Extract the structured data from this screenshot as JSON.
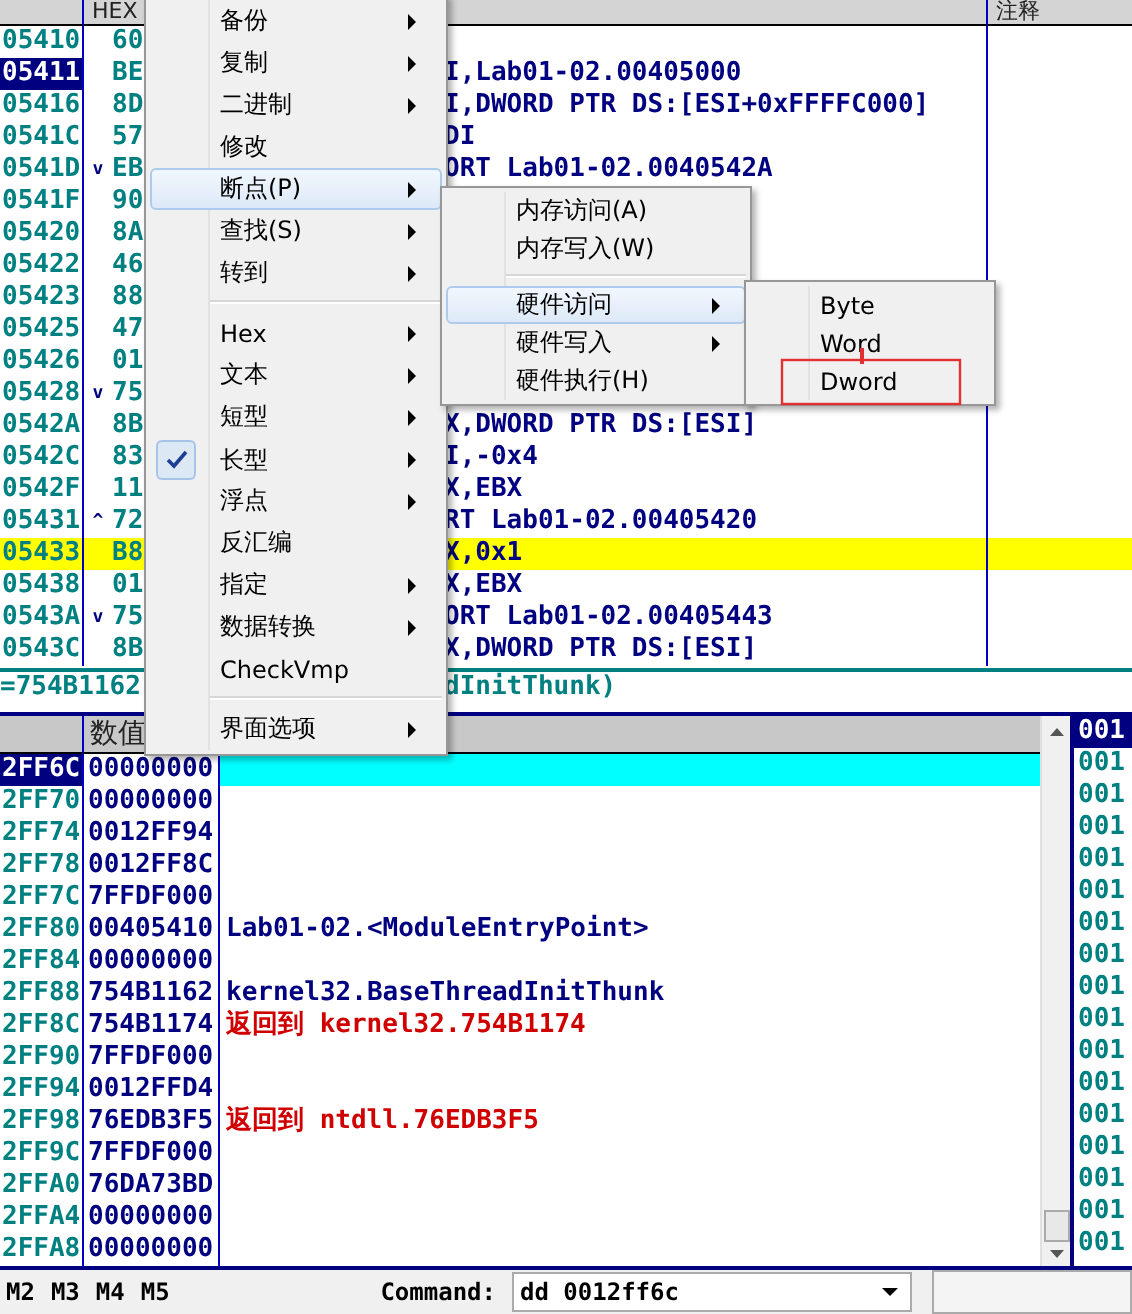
{
  "disassembly": {
    "columns": [
      {
        "label": "HEX"
      },
      {
        "label": "注释"
      }
    ],
    "rows": [
      {
        "address": "05410",
        "hex": "60",
        "jump": "",
        "code": "",
        "selected": false,
        "highlighted": false
      },
      {
        "address": "05411",
        "hex": "BE",
        "jump": "",
        "code": "I,Lab01-02.00405000",
        "selected": true,
        "highlighted": false
      },
      {
        "address": "05416",
        "hex": "8D",
        "jump": "",
        "code": "I,DWORD PTR DS:[ESI+0xFFFFC000]",
        "selected": false,
        "highlighted": false
      },
      {
        "address": "0541C",
        "hex": "57",
        "jump": "",
        "code": "DI",
        "selected": false,
        "highlighted": false
      },
      {
        "address": "0541D",
        "hex": "EB",
        "jump": "v",
        "code": "ORT Lab01-02.0040542A",
        "selected": false,
        "highlighted": false
      },
      {
        "address": "0541F",
        "hex": "90",
        "jump": "",
        "code": "",
        "selected": false,
        "highlighted": false
      },
      {
        "address": "05420",
        "hex": "8A",
        "jump": "",
        "code": "",
        "selected": false,
        "highlighted": false
      },
      {
        "address": "05422",
        "hex": "46",
        "jump": "",
        "code": "",
        "selected": false,
        "highlighted": false
      },
      {
        "address": "05423",
        "hex": "88",
        "jump": "",
        "code": "",
        "selected": false,
        "highlighted": false
      },
      {
        "address": "05425",
        "hex": "47",
        "jump": "",
        "code": "",
        "selected": false,
        "highlighted": false
      },
      {
        "address": "05426",
        "hex": "01",
        "jump": "",
        "code": "",
        "selected": false,
        "highlighted": false
      },
      {
        "address": "05428",
        "hex": "75",
        "jump": "v",
        "code": "",
        "selected": false,
        "highlighted": false
      },
      {
        "address": "0542A",
        "hex": "8B",
        "jump": "",
        "code": "X,DWORD PTR DS:[ESI]",
        "selected": false,
        "highlighted": false
      },
      {
        "address": "0542C",
        "hex": "83",
        "jump": "",
        "code": "I,-0x4",
        "selected": false,
        "highlighted": false
      },
      {
        "address": "0542F",
        "hex": "11",
        "jump": "",
        "code": "X,EBX",
        "selected": false,
        "highlighted": false
      },
      {
        "address": "05431",
        "hex": "72",
        "jump": "^",
        "code": "RT Lab01-02.00405420",
        "selected": false,
        "highlighted": false
      },
      {
        "address": "05433",
        "hex": "B8",
        "jump": "",
        "code": "X,0x1",
        "selected": false,
        "highlighted": true
      },
      {
        "address": "05438",
        "hex": "01",
        "jump": "",
        "code": "X,EBX",
        "selected": false,
        "highlighted": false
      },
      {
        "address": "0543A",
        "hex": "75",
        "jump": "v",
        "code": "ORT Lab01-02.00405443",
        "selected": false,
        "highlighted": false
      },
      {
        "address": "0543C",
        "hex": "8B",
        "jump": "",
        "code": "X,DWORD PTR DS:[ESI]",
        "selected": false,
        "highlighted": false
      }
    ]
  },
  "info_line": {
    "left": "=754B1162",
    "right": "dInitThunk)"
  },
  "stack": {
    "column": "数值",
    "rows": [
      {
        "address": "2FF6C",
        "value": "00000000",
        "comment": "",
        "kind": "plain",
        "selected": true
      },
      {
        "address": "2FF70",
        "value": "00000000",
        "comment": "",
        "kind": "plain",
        "selected": false
      },
      {
        "address": "2FF74",
        "value": "0012FF94",
        "comment": "",
        "kind": "plain",
        "selected": false
      },
      {
        "address": "2FF78",
        "value": "0012FF8C",
        "comment": "",
        "kind": "plain",
        "selected": false
      },
      {
        "address": "2FF7C",
        "value": "7FFDF000",
        "comment": "",
        "kind": "plain",
        "selected": false
      },
      {
        "address": "2FF80",
        "value": "00405410",
        "comment": "Lab01-02.<ModuleEntryPoint>",
        "kind": "plain",
        "selected": false
      },
      {
        "address": "2FF84",
        "value": "00000000",
        "comment": "",
        "kind": "plain",
        "selected": false
      },
      {
        "address": "2FF88",
        "value": "754B1162",
        "comment": "kernel32.BaseThreadInitThunk",
        "kind": "plain",
        "selected": false
      },
      {
        "address": "2FF8C",
        "value": "754B1174",
        "comment": "返回到 kernel32.754B1174",
        "kind": "return",
        "selected": false
      },
      {
        "address": "2FF90",
        "value": "7FFDF000",
        "comment": "",
        "kind": "plain",
        "selected": false
      },
      {
        "address": "2FF94",
        "value": "0012FFD4",
        "comment": "",
        "kind": "plain",
        "selected": false
      },
      {
        "address": "2FF98",
        "value": "76EDB3F5",
        "comment": "返回到 ntdll.76EDB3F5",
        "kind": "return",
        "selected": false
      },
      {
        "address": "2FF9C",
        "value": "7FFDF000",
        "comment": "",
        "kind": "plain",
        "selected": false
      },
      {
        "address": "2FFA0",
        "value": "76DA73BD",
        "comment": "",
        "kind": "plain",
        "selected": false
      },
      {
        "address": "2FFA4",
        "value": "00000000",
        "comment": "",
        "kind": "plain",
        "selected": false
      },
      {
        "address": "2FFA8",
        "value": "00000000",
        "comment": "",
        "kind": "plain",
        "selected": false
      }
    ]
  },
  "dump": {
    "rows": [
      {
        "text": "001",
        "selected": true
      },
      {
        "text": "001",
        "selected": false
      },
      {
        "text": "001",
        "selected": false
      },
      {
        "text": "001",
        "selected": false
      },
      {
        "text": "001",
        "selected": false
      },
      {
        "text": "001",
        "selected": false
      },
      {
        "text": "001",
        "selected": false
      },
      {
        "text": "001",
        "selected": false
      },
      {
        "text": "001",
        "selected": false
      },
      {
        "text": "001",
        "selected": false
      },
      {
        "text": "001",
        "selected": false
      },
      {
        "text": "001",
        "selected": false
      },
      {
        "text": "001",
        "selected": false
      },
      {
        "text": "001",
        "selected": false
      },
      {
        "text": "001",
        "selected": false
      },
      {
        "text": "001",
        "selected": false
      },
      {
        "text": "001",
        "selected": false
      }
    ]
  },
  "command_bar": {
    "memory_tabs": [
      "M2",
      "M3",
      "M4",
      "M5"
    ],
    "label": "Command:",
    "value": "dd 0012ff6c"
  },
  "context_menu": {
    "items": [
      {
        "kind": "item",
        "label": "备份",
        "submenu": true,
        "checked": false,
        "selected": false
      },
      {
        "kind": "item",
        "label": "复制",
        "submenu": true,
        "checked": false,
        "selected": false
      },
      {
        "kind": "item",
        "label": "二进制",
        "submenu": true,
        "checked": false,
        "selected": false
      },
      {
        "kind": "item",
        "label": "修改",
        "submenu": false,
        "checked": false,
        "selected": false
      },
      {
        "kind": "item",
        "label": "断点(P)",
        "submenu": true,
        "checked": false,
        "selected": true
      },
      {
        "kind": "item",
        "label": "查找(S)",
        "submenu": true,
        "checked": false,
        "selected": false
      },
      {
        "kind": "item",
        "label": "转到",
        "submenu": true,
        "checked": false,
        "selected": false
      },
      {
        "kind": "separator"
      },
      {
        "kind": "item",
        "label": "Hex",
        "submenu": true,
        "checked": false,
        "selected": false
      },
      {
        "kind": "item",
        "label": "文本",
        "submenu": true,
        "checked": false,
        "selected": false
      },
      {
        "kind": "item",
        "label": "短型",
        "submenu": true,
        "checked": false,
        "selected": false
      },
      {
        "kind": "item",
        "label": "长型",
        "submenu": true,
        "checked": true,
        "selected": false
      },
      {
        "kind": "item",
        "label": "浮点",
        "submenu": true,
        "checked": false,
        "selected": false
      },
      {
        "kind": "item",
        "label": "反汇编",
        "submenu": false,
        "checked": false,
        "selected": false
      },
      {
        "kind": "item",
        "label": "指定",
        "submenu": true,
        "checked": false,
        "selected": false
      },
      {
        "kind": "item",
        "label": "数据转换",
        "submenu": true,
        "checked": false,
        "selected": false
      },
      {
        "kind": "item",
        "label": "CheckVmp",
        "submenu": false,
        "checked": false,
        "selected": false
      },
      {
        "kind": "separator"
      },
      {
        "kind": "item",
        "label": "界面选项",
        "submenu": true,
        "checked": false,
        "selected": false
      }
    ]
  },
  "breakpoint_menu": {
    "items": [
      {
        "kind": "item",
        "label": "内存访问(A)",
        "submenu": false,
        "checked": false,
        "selected": false
      },
      {
        "kind": "item",
        "label": "内存写入(W)",
        "submenu": false,
        "checked": false,
        "selected": false
      },
      {
        "kind": "separator"
      },
      {
        "kind": "item",
        "label": "硬件访问",
        "submenu": true,
        "checked": false,
        "selected": true
      },
      {
        "kind": "item",
        "label": "硬件写入",
        "submenu": true,
        "checked": false,
        "selected": false
      },
      {
        "kind": "item",
        "label": "硬件执行(H)",
        "submenu": false,
        "checked": false,
        "selected": false
      }
    ]
  },
  "hardware_menu": {
    "items": [
      {
        "kind": "item",
        "label": "Byte",
        "submenu": false,
        "checked": false,
        "selected": false
      },
      {
        "kind": "item",
        "label": "Word",
        "submenu": false,
        "checked": false,
        "selected": false
      },
      {
        "kind": "item",
        "label": "Dword",
        "submenu": false,
        "checked": false,
        "selected": false
      }
    ]
  }
}
